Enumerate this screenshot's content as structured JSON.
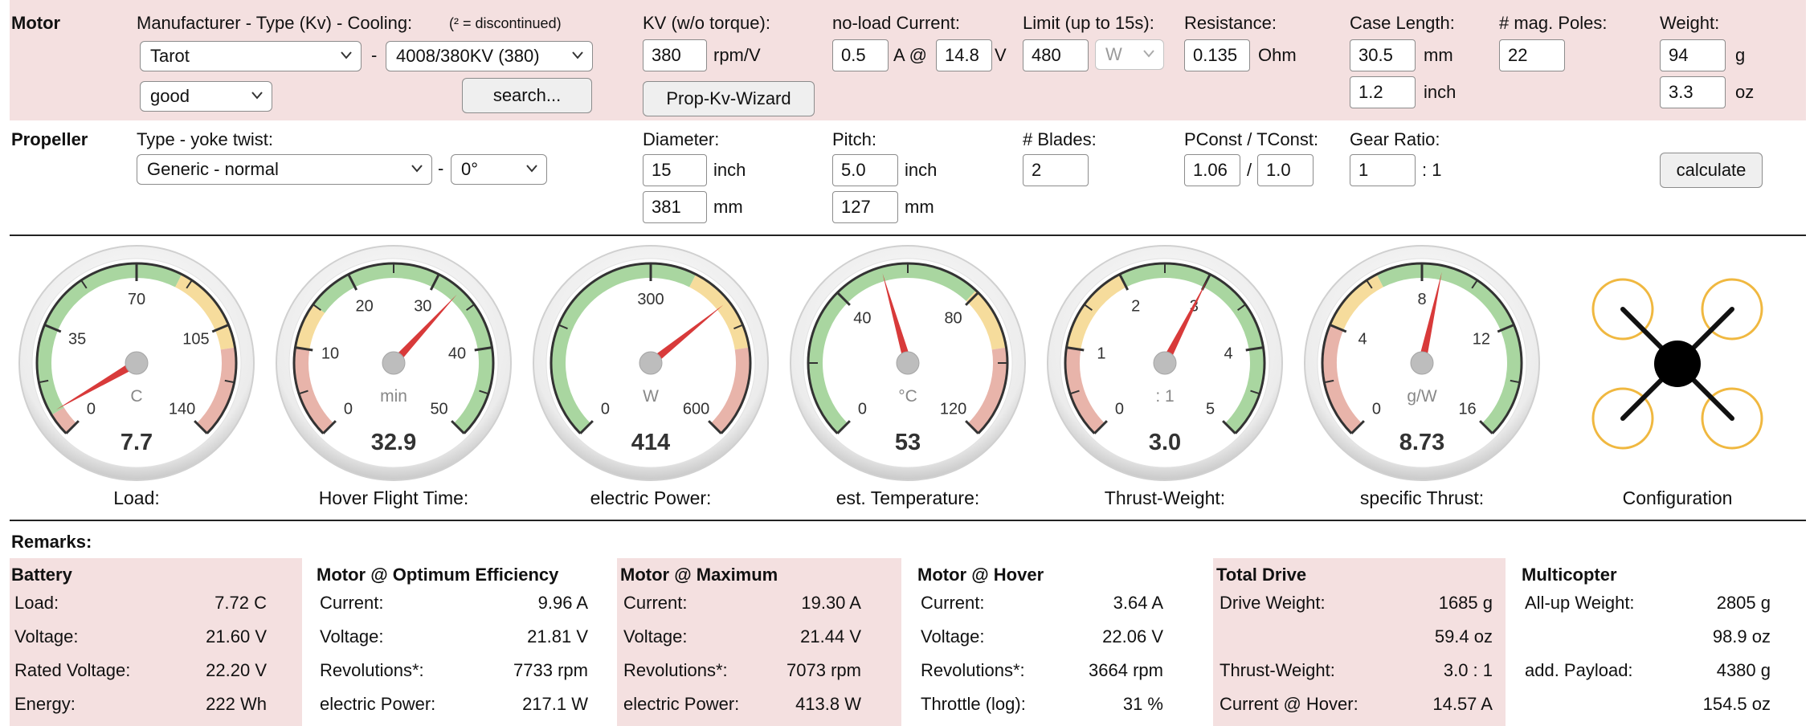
{
  "motor": {
    "section_label": "Motor",
    "manufacturer_label": "Manufacturer - Type (Kv) - Cooling:",
    "discontinued_note": "(² = discontinued)",
    "manufacturer": "Tarot",
    "separator": "-",
    "type": "4008/380KV (380)",
    "cooling": "good",
    "search_button": "search...",
    "kv_label": "KV (w/o torque):",
    "kv_value": "380",
    "kv_unit": "rpm/V",
    "prop_kv_wizard_button": "Prop-Kv-Wizard",
    "noload_label": "no-load Current:",
    "noload_current": "0.5",
    "noload_unit_a": "A @",
    "noload_voltage": "14.8",
    "noload_unit_v": "V",
    "limit_label": "Limit (up to 15s):",
    "limit_value": "480",
    "limit_unit": "W",
    "resistance_label": "Resistance:",
    "resistance_value": "0.135",
    "resistance_unit": "Ohm",
    "case_length_label": "Case Length:",
    "case_length_mm": "30.5",
    "case_length_mm_unit": "mm",
    "case_length_inch": "1.2",
    "case_length_inch_unit": "inch",
    "poles_label": "# mag. Poles:",
    "poles_value": "22",
    "weight_label": "Weight:",
    "weight_g": "94",
    "weight_g_unit": "g",
    "weight_oz": "3.3",
    "weight_oz_unit": "oz"
  },
  "propeller": {
    "section_label": "Propeller",
    "type_label": "Type - yoke twist:",
    "type": "Generic - normal",
    "separator": "-",
    "yoke_twist": "0°",
    "diameter_label": "Diameter:",
    "diameter_inch": "15",
    "diameter_inch_unit": "inch",
    "diameter_mm": "381",
    "diameter_mm_unit": "mm",
    "pitch_label": "Pitch:",
    "pitch_inch": "5.0",
    "pitch_inch_unit": "inch",
    "pitch_mm": "127",
    "pitch_mm_unit": "mm",
    "blades_label": "# Blades:",
    "blades_value": "2",
    "pconst_label": "PConst / TConst:",
    "pconst_value": "1.06",
    "slash": "/",
    "tconst_value": "1.0",
    "gear_label": "Gear Ratio:",
    "gear_value": "1",
    "gear_suffix": ": 1",
    "calculate_button": "calculate"
  },
  "gauges": [
    {
      "label": "Load:",
      "unit": "C",
      "value": "7.7",
      "min": 0,
      "max": 140,
      "ticks": [
        "0",
        "35",
        "70",
        "105",
        "140"
      ],
      "needle": 7.7,
      "bands": [
        {
          "from": 0,
          "to": 0.05,
          "color": "#e8b4aa"
        },
        {
          "from": 0.05,
          "to": 0.6,
          "color": "#a9d6a0"
        },
        {
          "from": 0.6,
          "to": 0.8,
          "color": "#f6dc9c"
        },
        {
          "from": 0.8,
          "to": 1,
          "color": "#e8b4aa"
        }
      ]
    },
    {
      "label": "Hover Flight Time:",
      "unit": "min",
      "value": "32.9",
      "min": 0,
      "max": 50,
      "ticks": [
        "0",
        "10",
        "20",
        "30",
        "40",
        "50"
      ],
      "needle": 32.9,
      "bands": [
        {
          "from": 0,
          "to": 0.2,
          "color": "#e8b4aa"
        },
        {
          "from": 0.2,
          "to": 0.3,
          "color": "#f6dc9c"
        },
        {
          "from": 0.3,
          "to": 1,
          "color": "#a9d6a0"
        }
      ]
    },
    {
      "label": "electric Power:",
      "unit": "W",
      "value": "414",
      "min": 0,
      "max": 600,
      "ticks": [
        "0",
        "300",
        "600"
      ],
      "needle": 414,
      "bands": [
        {
          "from": 0,
          "to": 0.6,
          "color": "#a9d6a0"
        },
        {
          "from": 0.6,
          "to": 0.8,
          "color": "#f6dc9c"
        },
        {
          "from": 0.8,
          "to": 1,
          "color": "#e8b4aa"
        }
      ]
    },
    {
      "label": "est. Temperature:",
      "unit": "°C",
      "value": "53",
      "min": 0,
      "max": 120,
      "ticks": [
        "0",
        "40",
        "80",
        "120"
      ],
      "needle": 53,
      "bands": [
        {
          "from": 0,
          "to": 0.66,
          "color": "#a9d6a0"
        },
        {
          "from": 0.66,
          "to": 0.8,
          "color": "#f6dc9c"
        },
        {
          "from": 0.8,
          "to": 1,
          "color": "#e8b4aa"
        }
      ]
    },
    {
      "label": "Thrust-Weight:",
      "unit": ": 1",
      "value": "3.0",
      "min": 0,
      "max": 5,
      "ticks": [
        "0",
        "1",
        "2",
        "3",
        "4",
        "5"
      ],
      "needle": 3.0,
      "bands": [
        {
          "from": 0,
          "to": 0.2,
          "color": "#e8b4aa"
        },
        {
          "from": 0.2,
          "to": 0.4,
          "color": "#f6dc9c"
        },
        {
          "from": 0.4,
          "to": 1,
          "color": "#a9d6a0"
        }
      ]
    },
    {
      "label": "specific Thrust:",
      "unit": "g/W",
      "value": "8.73",
      "min": 0,
      "max": 16,
      "ticks": [
        "0",
        "4",
        "8",
        "12",
        "16"
      ],
      "needle": 8.73,
      "bands": [
        {
          "from": 0,
          "to": 0.25,
          "color": "#e8b4aa"
        },
        {
          "from": 0.25,
          "to": 0.4,
          "color": "#f6dc9c"
        },
        {
          "from": 0.4,
          "to": 1,
          "color": "#a9d6a0"
        }
      ]
    }
  ],
  "configuration": {
    "label": "Configuration",
    "rotor_color": "#f0b840"
  },
  "remarks_label": "Remarks:",
  "tables": [
    {
      "title": "Battery",
      "shaded": true,
      "rows": [
        {
          "label": "Load:",
          "value": "7.72 C"
        },
        {
          "label": "Voltage:",
          "value": "21.60 V"
        },
        {
          "label": "Rated Voltage:",
          "value": "22.20 V"
        },
        {
          "label": "Energy:",
          "value": "222 Wh"
        }
      ]
    },
    {
      "title": "Motor @ Optimum Efficiency",
      "shaded": false,
      "rows": [
        {
          "label": "Current:",
          "value": "9.96 A"
        },
        {
          "label": "Voltage:",
          "value": "21.81 V"
        },
        {
          "label": "Revolutions*:",
          "value": "7733 rpm"
        },
        {
          "label": "electric Power:",
          "value": "217.1 W"
        }
      ]
    },
    {
      "title": "Motor @ Maximum",
      "shaded": true,
      "rows": [
        {
          "label": "Current:",
          "value": "19.30 A"
        },
        {
          "label": "Voltage:",
          "value": "21.44 V"
        },
        {
          "label": "Revolutions*:",
          "value": "7073 rpm"
        },
        {
          "label": "electric Power:",
          "value": "413.8 W"
        }
      ]
    },
    {
      "title": "Motor @ Hover",
      "shaded": false,
      "rows": [
        {
          "label": "Current:",
          "value": "3.64 A"
        },
        {
          "label": "Voltage:",
          "value": "22.06 V"
        },
        {
          "label": "Revolutions*:",
          "value": "3664 rpm"
        },
        {
          "label": "Throttle (log):",
          "value": "31 %"
        }
      ]
    },
    {
      "title": "Total Drive",
      "shaded": true,
      "rows": [
        {
          "label": "Drive Weight:",
          "value": "1685 g"
        },
        {
          "label": "",
          "value": "59.4 oz"
        },
        {
          "label": "Thrust-Weight:",
          "value": "3.0 : 1"
        },
        {
          "label": "Current @ Hover:",
          "value": "14.57 A"
        }
      ]
    },
    {
      "title": "Multicopter",
      "shaded": false,
      "rows": [
        {
          "label": "All-up Weight:",
          "value": "2805 g"
        },
        {
          "label": "",
          "value": "98.9 oz"
        },
        {
          "label": "add. Payload:",
          "value": "4380 g"
        },
        {
          "label": "",
          "value": "154.5 oz"
        }
      ]
    }
  ]
}
